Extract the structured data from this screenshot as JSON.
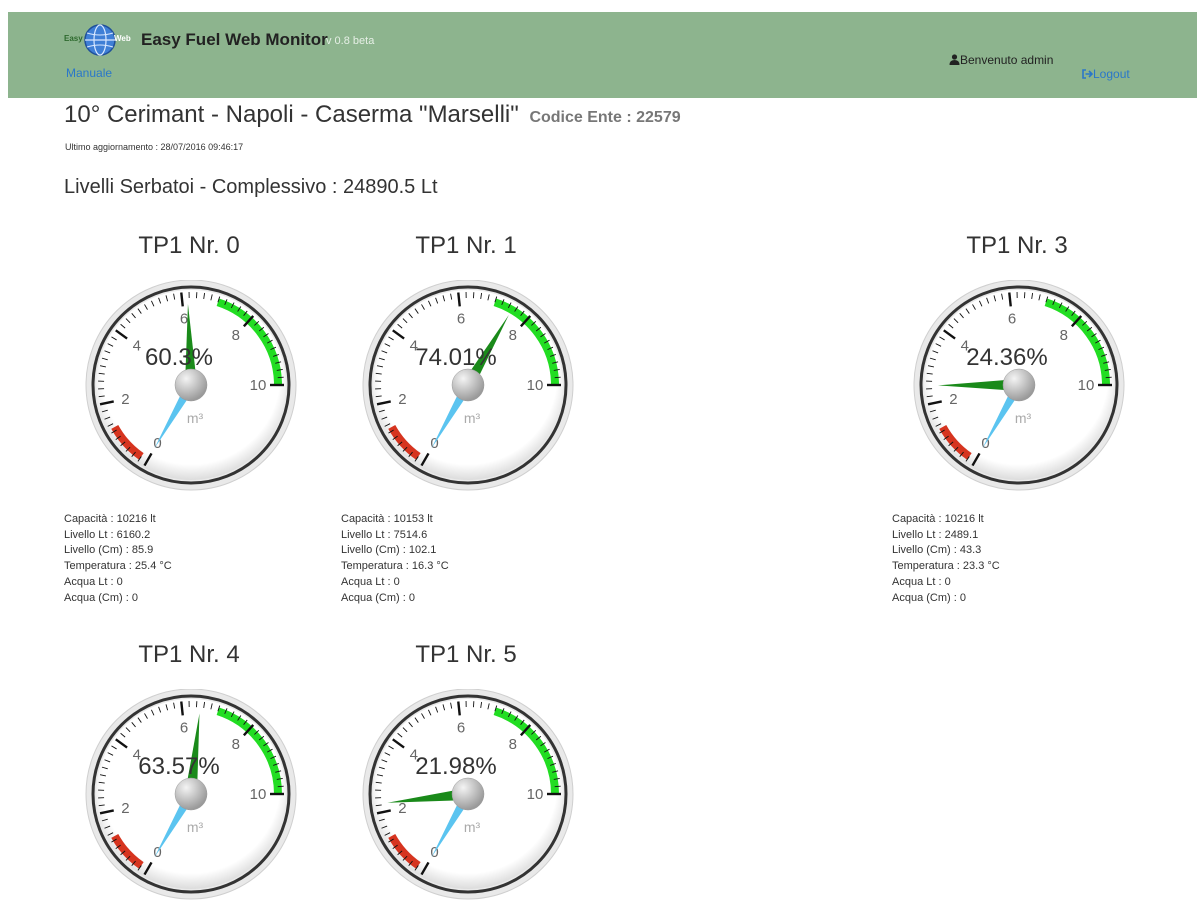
{
  "header": {
    "logo_left": "Easy",
    "logo_right": "Web",
    "app_title": "Easy Fuel Web Monitor",
    "version": "v 0.8 beta",
    "manual_link": "Manuale",
    "welcome": "Benvenuto admin",
    "logout_link": "Logout",
    "colors": {
      "bar": "#8db48e",
      "link": "#2a77c9"
    }
  },
  "page": {
    "title": "10° Cerimant - Napoli - Caserma \"Marselli\"",
    "code_label": "Codice Ente : 22579",
    "last_update": "Ultimo aggiornamento : 28/07/2016 09:46:17",
    "summary": "Livelli Serbatoi - Complessivo : 24890.5 Lt"
  },
  "gauge_common": {
    "unit": "m³",
    "scale_labels": [
      "0",
      "2",
      "4",
      "6",
      "8",
      "10"
    ]
  },
  "tanks": [
    {
      "title": "TP1 Nr. 0",
      "percent": "60.3%",
      "value_m3": 6.16,
      "details": [
        "Capacità : 10216 lt",
        "Livello Lt : 6160.2",
        "Livello (Cm) : 85.9",
        "Temperatura : 25.4 °C",
        "Acqua Lt : 0",
        "Acqua (Cm) : 0"
      ]
    },
    {
      "title": "TP1 Nr. 1",
      "percent": "74.01%",
      "value_m3": 7.51,
      "details": [
        "Capacità : 10153 lt",
        "Livello Lt : 7514.6",
        "Livello (Cm) : 102.1",
        "Temperatura : 16.3 °C",
        "Acqua Lt : 0",
        "Acqua (Cm) : 0"
      ]
    },
    {
      "title": "TP1 Nr. 3",
      "percent": "24.36%",
      "value_m3": 2.49,
      "details": [
        "Capacità : 10216 lt",
        "Livello Lt : 2489.1",
        "Livello (Cm) : 43.3",
        "Temperatura : 23.3 °C",
        "Acqua Lt : 0",
        "Acqua (Cm) : 0"
      ]
    },
    {
      "title": "TP1 Nr. 4",
      "percent": "63.57%",
      "value_m3": 6.5,
      "details": []
    },
    {
      "title": "TP1 Nr. 5",
      "percent": "21.98%",
      "value_m3": 2.24,
      "details": []
    }
  ]
}
